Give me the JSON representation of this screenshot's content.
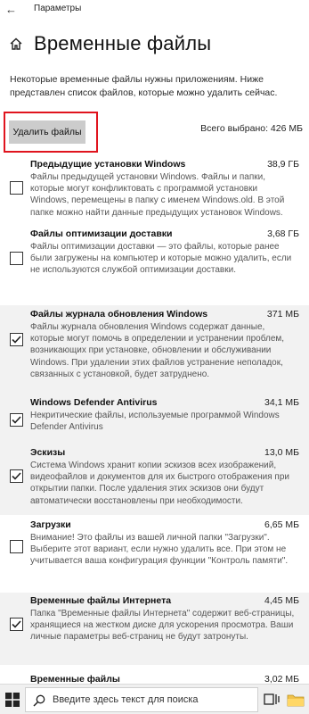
{
  "window": {
    "title": "Параметры"
  },
  "header": {
    "title": "Временные файлы"
  },
  "description": "Некоторые временные файлы нужны приложениям. Ниже представлен список файлов, которые можно удалить сейчас.",
  "actions": {
    "delete_label": "Удалить файлы",
    "total_selected": "Всего выбрано: 426 МБ"
  },
  "items": [
    {
      "title": "Предыдущие установки Windows",
      "size": "38,9 ГБ",
      "checked": false,
      "description": "Файлы предыдущей установки Windows. Файлы и папки, которые могут конфликтовать с программой установки Windows, перемещены в папку с именем Windows.old. В этой папке можно найти данные предыдущих установок Windows."
    },
    {
      "title": "Файлы оптимизации доставки",
      "size": "3,68 ГБ",
      "checked": false,
      "description": "Файлы оптимизации доставки — это файлы, которые ранее были загружены на компьютер и которые можно удалить, если не используются службой оптимизации доставки."
    },
    {
      "title": "Файлы журнала обновления Windows",
      "size": "371 МБ",
      "checked": true,
      "description": "Файлы журнала обновления Windows содержат данные, которые могут помочь в определении и устранении проблем, возникающих при установке, обновлении и обслуживании Windows. При удалении этих файлов устранение неполадок, связанных с установкой, будет затруднено."
    },
    {
      "title": "Windows Defender Antivirus",
      "size": "34,1 МБ",
      "checked": true,
      "description": "Некритические файлы, используемые программой Windows Defender Antivirus"
    },
    {
      "title": "Эскизы",
      "size": "13,0 МБ",
      "checked": true,
      "description": "Система Windows хранит копии эскизов всех изображений, видеофайлов и документов для их быстрого отображения при открытии папки. После удаления этих эскизов они будут автоматически восстановлены при необходимости."
    },
    {
      "title": "Загрузки",
      "size": "6,65 МБ",
      "checked": false,
      "description": "Внимание! Это файлы из вашей личной папки \"Загрузки\". Выберите этот вариант, если нужно удалить все. При этом не учитывается ваша конфигурация функции \"Контроль памяти\"."
    },
    {
      "title": "Временные файлы Интернета",
      "size": "4,45 МБ",
      "checked": true,
      "description": "Папка \"Временные файлы Интернета\" содержит веб-страницы, хранящиеся на жестком диске для ускорения просмотра. Ваши личные параметры веб-страниц не будут затронуты."
    },
    {
      "title": "Временные файлы",
      "size": "3,02 МБ",
      "checked": false,
      "description": ""
    }
  ],
  "taskbar": {
    "search_placeholder": "Введите здесь текст для поиска"
  },
  "colors": {
    "highlight_border": "#e0141e",
    "button_bg": "#cccccc",
    "shaded_row": "#f2f2f2"
  }
}
